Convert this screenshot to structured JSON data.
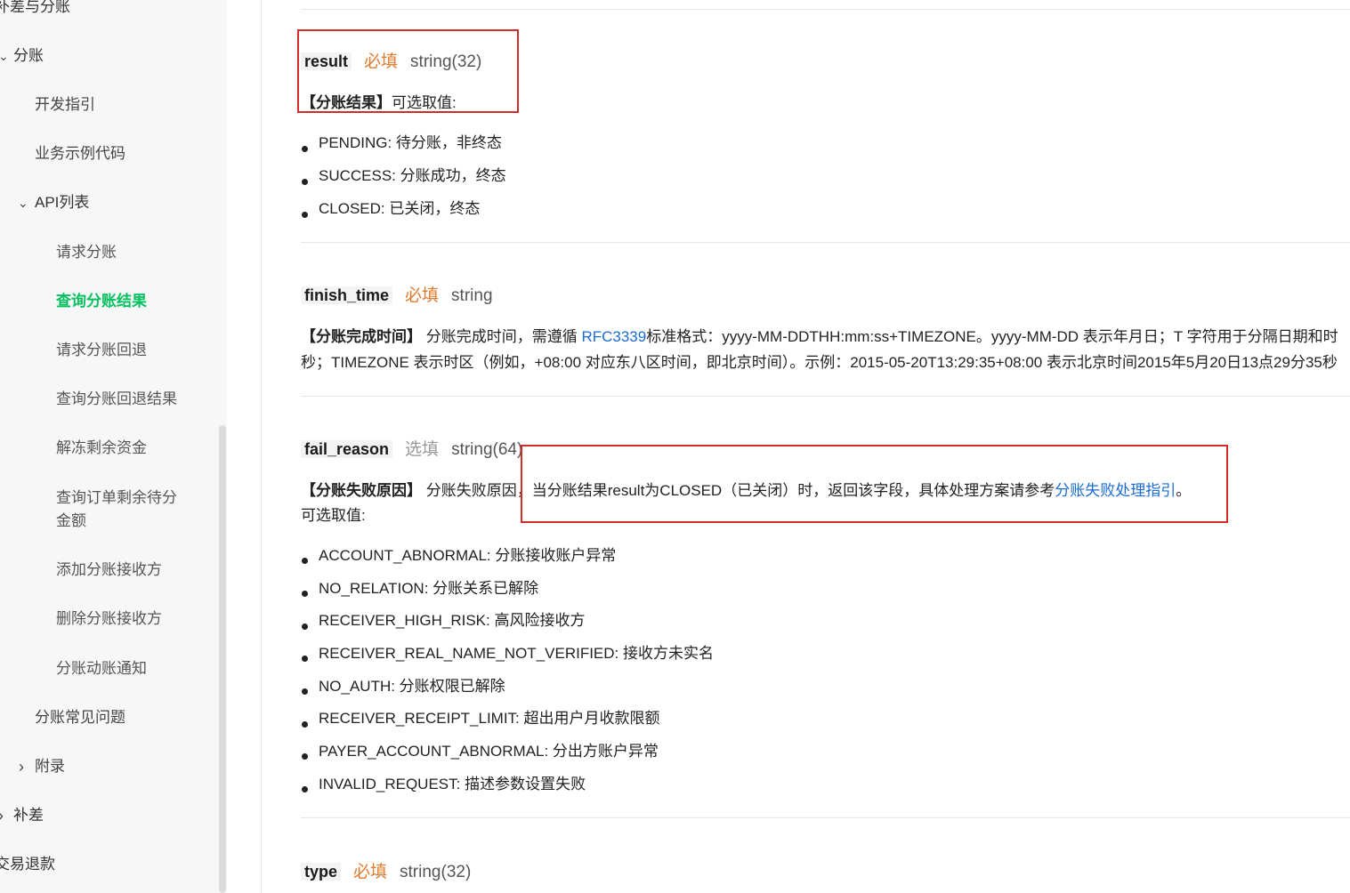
{
  "sidebar": {
    "items": [
      {
        "label": "补差与分账"
      },
      {
        "label": "分账"
      },
      {
        "label": "开发指引"
      },
      {
        "label": "业务示例代码"
      },
      {
        "label": "API列表"
      },
      {
        "label": "请求分账"
      },
      {
        "label": "查询分账结果"
      },
      {
        "label": "请求分账回退"
      },
      {
        "label": "查询分账回退结果"
      },
      {
        "label": "解冻剩余资金"
      },
      {
        "label": "查询订单剩余待分"
      },
      {
        "label": "金额"
      },
      {
        "label": "添加分账接收方"
      },
      {
        "label": "删除分账接收方"
      },
      {
        "label": "分账动账通知"
      },
      {
        "label": "分账常见问题"
      },
      {
        "label": "附录"
      },
      {
        "label": "补差"
      },
      {
        "label": "交易退款"
      }
    ],
    "chevron_down": "⌄",
    "chevron_right": "›"
  },
  "fields": {
    "result": {
      "name": "result",
      "required": "必填",
      "type": "string(32)",
      "desc_title": "【分账结果】",
      "desc_text": "可选取值:",
      "values": [
        "PENDING: 待分账，非终态",
        "SUCCESS: 分账成功，终态",
        "CLOSED: 已关闭，终态"
      ]
    },
    "finish_time": {
      "name": "finish_time",
      "required": "必填",
      "type": "string",
      "desc_title": "【分账完成时间】",
      "desc_pre": " 分账完成时间，需遵循 ",
      "desc_link": "RFC3339",
      "desc_post": "标准格式：yyyy-MM-DDTHH:mm:ss+TIMEZONE。yyyy-MM-DD 表示年月日；T 字符用于分隔日期和时",
      "desc_line2": "秒；TIMEZONE 表示时区（例如，+08:00 对应东八区时间，即北京时间）。示例：2015-05-20T13:29:35+08:00 表示北京时间2015年5月20日13点29分35秒"
    },
    "fail_reason": {
      "name": "fail_reason",
      "required": "选填",
      "type": "string(64)",
      "desc_title": "【分账失败原因】",
      "desc_pre": " 分账失败原因，当分账结果result为CLOSED（已关闭）时，返回该字段，具体处理方案请参考",
      "desc_link": "分账失败处理指引",
      "desc_post": "。",
      "desc_line2": "可选取值:",
      "values": [
        "ACCOUNT_ABNORMAL: 分账接收账户异常",
        "NO_RELATION: 分账关系已解除",
        "RECEIVER_HIGH_RISK: 高风险接收方",
        "RECEIVER_REAL_NAME_NOT_VERIFIED: 接收方未实名",
        "NO_AUTH: 分账权限已解除",
        "RECEIVER_RECEIPT_LIMIT: 超出用户月收款限额",
        "PAYER_ACCOUNT_ABNORMAL: 分出方账户异常",
        "INVALID_REQUEST: 描述参数设置失败"
      ]
    },
    "type": {
      "name": "type",
      "required": "必填",
      "type": "string(32)"
    }
  },
  "colors": {
    "accent_green": "#07c160",
    "required_orange": "#e07a2d",
    "link_blue": "#1a6bd6",
    "annotation_red": "#d42a2a"
  }
}
